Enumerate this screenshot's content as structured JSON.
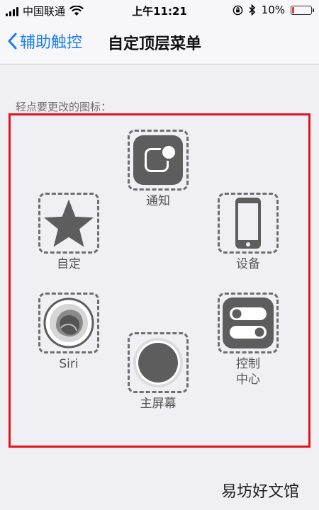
{
  "status_bar": {
    "carrier": "中国联通",
    "time": "上午11:21",
    "battery": "10%",
    "battery_level": 0.1
  },
  "nav": {
    "back_label": "辅助触控",
    "title": "自定顶层菜单"
  },
  "hint": "轻点要更改的图标：",
  "menu_items": [
    {
      "label": "通知",
      "icon": "notification-icon"
    },
    {
      "label": "自定",
      "icon": "star-icon"
    },
    {
      "label": "设备",
      "icon": "device-icon"
    },
    {
      "label": "Siri",
      "icon": "siri-icon"
    },
    {
      "label": "控制",
      "label2": "中心",
      "icon": "control-center-icon"
    },
    {
      "label": "主屏幕",
      "icon": "home-icon"
    }
  ],
  "watermark": "易坊好文馆",
  "colors": {
    "accent": "#1a7cf5",
    "highlight_border": "#e0141e",
    "battery_low": "#e23b3b"
  }
}
